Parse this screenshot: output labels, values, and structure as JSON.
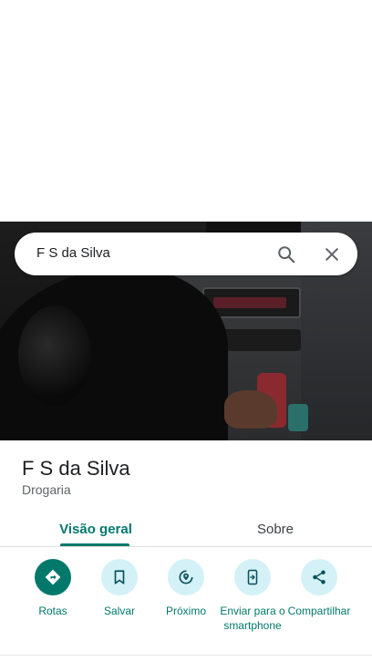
{
  "search": {
    "query": "F S da Silva",
    "search_icon": "search-icon",
    "close_icon": "close-icon"
  },
  "place": {
    "name": "F S da Silva",
    "category": "Drogaria"
  },
  "tabs": [
    {
      "label": "Visão geral",
      "selected": true
    },
    {
      "label": "Sobre",
      "selected": false
    }
  ],
  "actions": [
    {
      "label": "Rotas",
      "icon": "directions-icon"
    },
    {
      "label": "Salvar",
      "icon": "bookmark-icon"
    },
    {
      "label": "Próximo",
      "icon": "nearby-icon"
    },
    {
      "label": "Enviar para o smartphone",
      "icon": "send-to-phone-icon"
    },
    {
      "label": "Compartilhar",
      "icon": "share-icon"
    }
  ],
  "colors": {
    "accent": "#00796b",
    "action_bg": "#d3f1f7",
    "text_primary": "#202124",
    "text_secondary": "#5f6368"
  }
}
